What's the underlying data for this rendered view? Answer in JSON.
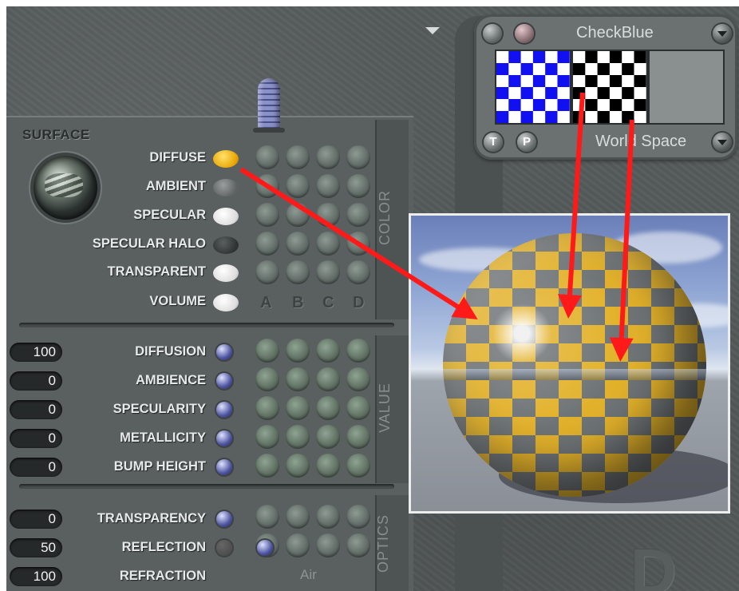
{
  "surface_tab": "SURFACE",
  "color_rows": [
    {
      "label": "DIFFUSE",
      "dot": "yellow"
    },
    {
      "label": "AMBIENT",
      "dot": "grey"
    },
    {
      "label": "SPECULAR",
      "dot": "white"
    },
    {
      "label": "SPECULAR HALO",
      "dot": "dark"
    },
    {
      "label": "TRANSPARENT",
      "dot": "white"
    },
    {
      "label": "VOLUME",
      "dot": "white"
    }
  ],
  "channel_labels": [
    "A",
    "B",
    "C",
    "D"
  ],
  "section_labels": {
    "color": "COLOR",
    "value": "VALUE",
    "optics": "OPTICS"
  },
  "value_rows": [
    {
      "value": "100",
      "label": "DIFFUSION"
    },
    {
      "value": "0",
      "label": "AMBIENCE"
    },
    {
      "value": "0",
      "label": "SPECULARITY"
    },
    {
      "value": "0",
      "label": "METALLICITY"
    },
    {
      "value": "0",
      "label": "BUMP HEIGHT"
    }
  ],
  "optics_rows": [
    {
      "value": "0",
      "label": "TRANSPARENCY"
    },
    {
      "value": "50",
      "label": "REFLECTION"
    },
    {
      "value": "100",
      "label": "REFRACTION"
    }
  ],
  "refraction_medium": "Air",
  "texture_panel": {
    "title": "CheckBlue",
    "mapping": "World Space",
    "t_button": "T",
    "p_button": "P"
  },
  "watermark": "D",
  "colors": {
    "diffuse": "#e8a400",
    "swatch_blue": "#1010f0",
    "arrow": "#ff1a1a"
  }
}
